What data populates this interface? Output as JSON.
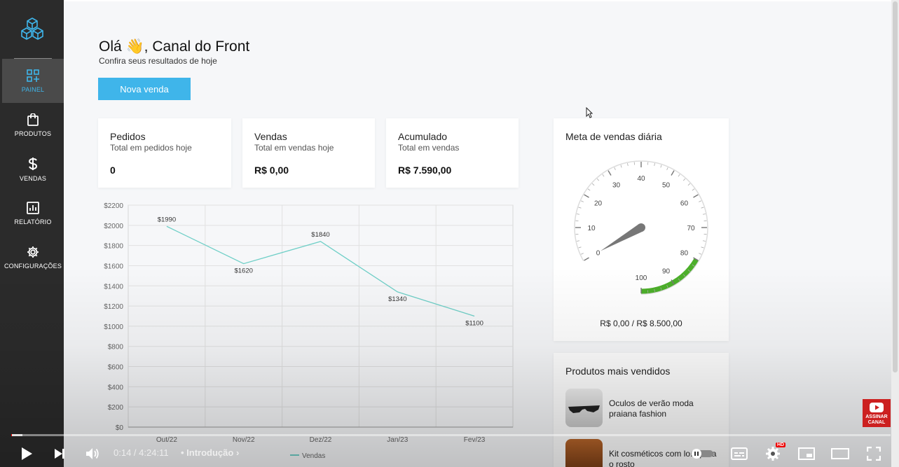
{
  "sidebar": {
    "items": [
      {
        "label": "PAINEL",
        "icon": "dashboard-icon",
        "active": true
      },
      {
        "label": "PRODUTOS",
        "icon": "shopping-bag-icon",
        "active": false
      },
      {
        "label": "VENDAS",
        "icon": "dollar-icon",
        "active": false
      },
      {
        "label": "RELATÓRIO",
        "icon": "report-icon",
        "active": false
      },
      {
        "label": "CONFIGURAÇÕES",
        "icon": "gear-icon",
        "active": false
      }
    ]
  },
  "header": {
    "greeting": "Olá 👋, Canal do Front",
    "subtitle": "Confira seus resultados de hoje",
    "new_sale_button": "Nova venda"
  },
  "cards": [
    {
      "title": "Pedidos",
      "subtitle": "Total em pedidos hoje",
      "value": "0"
    },
    {
      "title": "Vendas",
      "subtitle": "Total em vendas hoje",
      "value": "R$ 0,00"
    },
    {
      "title": "Acumulado",
      "subtitle": "Total em vendas",
      "value": "R$ 7.590,00"
    }
  ],
  "chart_data": {
    "type": "line",
    "categories": [
      "Out/22",
      "Nov/22",
      "Dez/22",
      "Jan/23",
      "Fev/23"
    ],
    "series": [
      {
        "name": "Vendas",
        "values": [
          1990,
          1620,
          1840,
          1340,
          1100
        ],
        "color": "#6fcfc7"
      }
    ],
    "data_labels": [
      "$1990",
      "$1620",
      "$1840",
      "$1340",
      "$1100"
    ],
    "y_ticks": [
      "$0",
      "$200",
      "$400",
      "$600",
      "$800",
      "$1000",
      "$1200",
      "$1400",
      "$1600",
      "$1800",
      "$2000",
      "$2200"
    ],
    "ylim": [
      0,
      2200
    ],
    "grid": true,
    "legend": "bottom"
  },
  "goal": {
    "title": "Meta de vendas diária",
    "value_text": "R$ 0,00 / R$ 8.500,00",
    "gauge_labels": [
      "0",
      "10",
      "20",
      "30",
      "40",
      "50",
      "60",
      "70",
      "80",
      "90",
      "100"
    ],
    "needle_value": 0,
    "accent": "#4caf2a"
  },
  "top_products": {
    "title": "Produtos mais vendidos",
    "items": [
      {
        "name": "Oculos de verão moda praiana fashion"
      },
      {
        "name": "Kit cosméticos com lo... para o rosto"
      }
    ]
  },
  "player": {
    "time": "0:14 / 4:24:11",
    "chapter": "• Introdução",
    "subscribe_label": "ASSINAR CANAL",
    "hd_badge": "HD",
    "progress_fraction": 0.00088
  }
}
